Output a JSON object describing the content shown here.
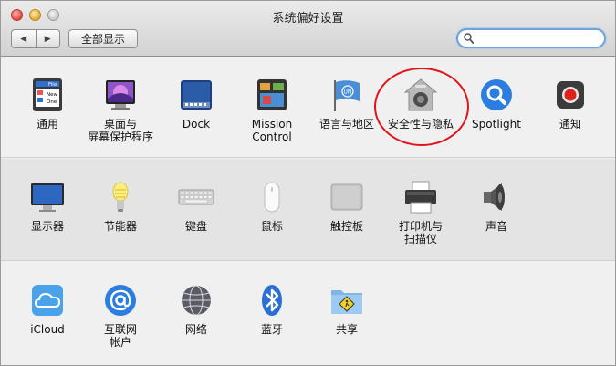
{
  "window": {
    "title": "系统偏好设置"
  },
  "toolbar": {
    "back_glyph": "◀",
    "forward_glyph": "▶",
    "show_all_label": "全部显示"
  },
  "search": {
    "placeholder": "",
    "value": ""
  },
  "sections": {
    "personal": {
      "items": [
        {
          "name": "general",
          "label": "通用",
          "icon": "general-icon"
        },
        {
          "name": "desktop-screensaver",
          "label": "桌面与\n屏幕保护程序",
          "icon": "desktop-icon"
        },
        {
          "name": "dock",
          "label": "Dock",
          "icon": "dock-icon"
        },
        {
          "name": "mission-control",
          "label": "Mission\nControl",
          "icon": "mission-control-icon"
        },
        {
          "name": "language-region",
          "label": "语言与地区",
          "icon": "flag-icon"
        },
        {
          "name": "security-privacy",
          "label": "安全性与隐私",
          "icon": "house-lock-icon"
        },
        {
          "name": "spotlight",
          "label": "Spotlight",
          "icon": "magnifier-icon"
        },
        {
          "name": "notifications",
          "label": "通知",
          "icon": "notification-icon"
        }
      ]
    },
    "hardware": {
      "items": [
        {
          "name": "displays",
          "label": "显示器",
          "icon": "monitor-icon"
        },
        {
          "name": "energy-saver",
          "label": "节能器",
          "icon": "bulb-icon"
        },
        {
          "name": "keyboard",
          "label": "键盘",
          "icon": "keyboard-icon"
        },
        {
          "name": "mouse",
          "label": "鼠标",
          "icon": "mouse-icon"
        },
        {
          "name": "trackpad",
          "label": "触控板",
          "icon": "trackpad-icon"
        },
        {
          "name": "printers-scanners",
          "label": "打印机与\n扫描仪",
          "icon": "printer-icon"
        },
        {
          "name": "sound",
          "label": "声音",
          "icon": "speaker-icon"
        }
      ]
    },
    "internet": {
      "items": [
        {
          "name": "icloud",
          "label": "iCloud",
          "icon": "cloud-icon"
        },
        {
          "name": "internet-accounts",
          "label": "互联网\n帐户",
          "icon": "at-icon"
        },
        {
          "name": "network",
          "label": "网络",
          "icon": "globe-icon"
        },
        {
          "name": "bluetooth",
          "label": "蓝牙",
          "icon": "bluetooth-icon"
        },
        {
          "name": "sharing",
          "label": "共享",
          "icon": "sharing-folder-icon"
        }
      ]
    }
  },
  "annotation": {
    "highlighted_item": "security-privacy",
    "color": "#e0141a"
  },
  "colors": {
    "accent_blue": "#2b7de0",
    "search_focus": "#6fa3dd"
  },
  "general_icon_text": {
    "line1": "File",
    "line2": "New",
    "line3": "One"
  },
  "language_icon_text": "UN"
}
